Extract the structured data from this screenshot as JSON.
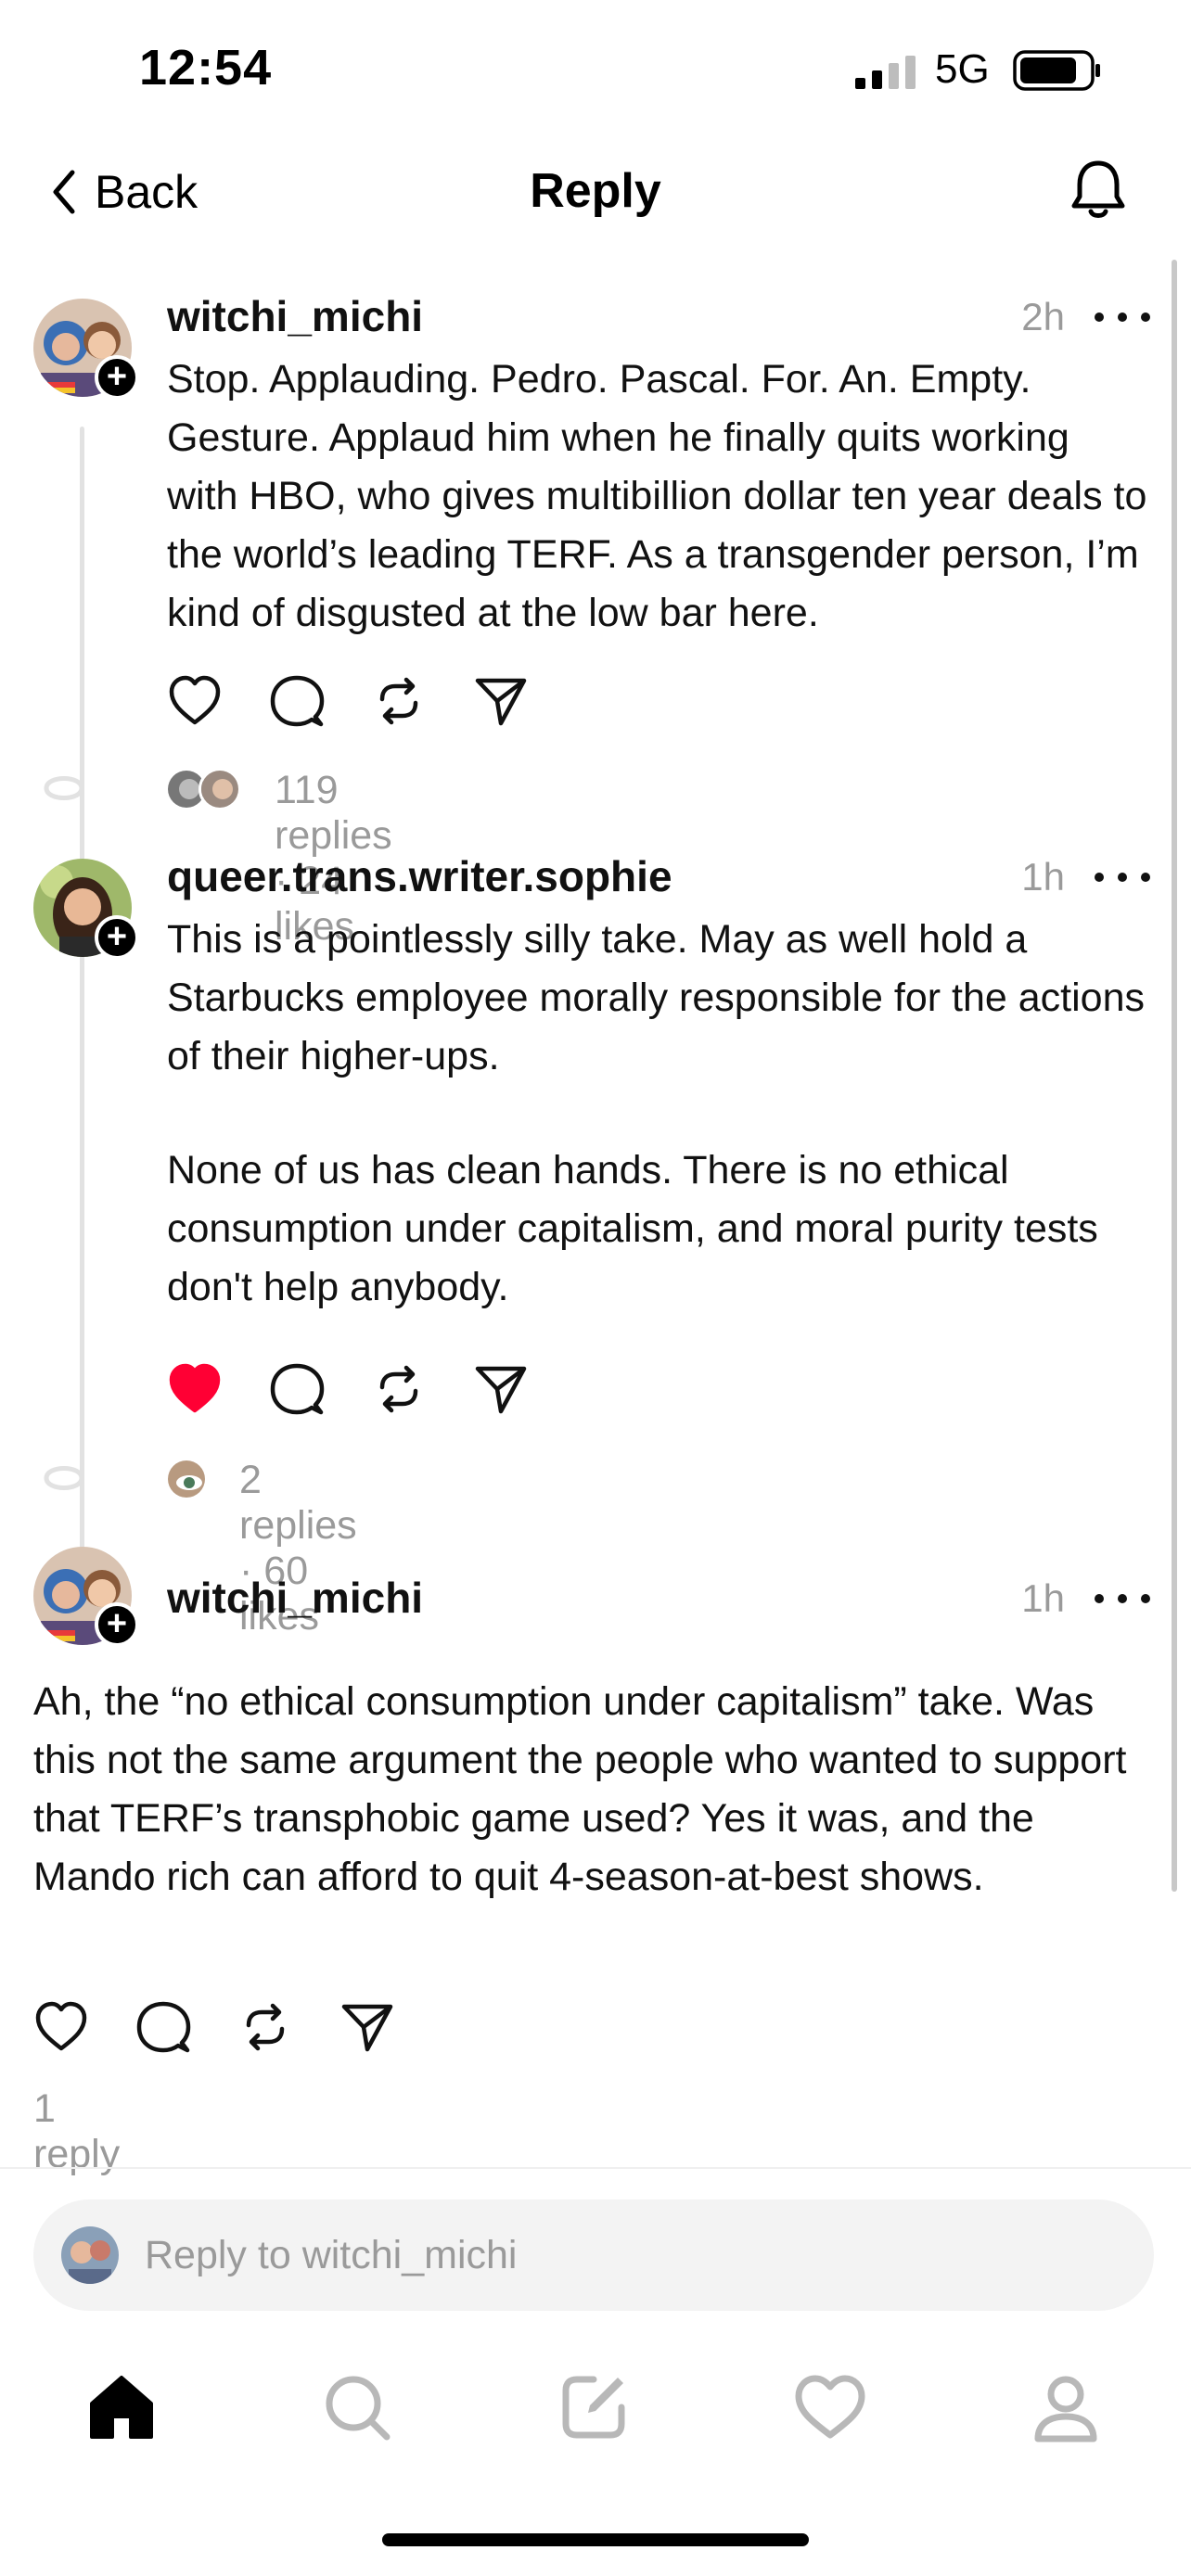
{
  "status_bar": {
    "time": "12:54",
    "network": "5G"
  },
  "nav": {
    "back_label": "Back",
    "title": "Reply"
  },
  "posts": [
    {
      "username": "witchi_michi",
      "timestamp": "2h",
      "paragraphs": [
        "Stop. Applauding. Pedro. Pascal. For. An. Empty. Gesture. Applaud him when he finally quits working with HBO, who gives multibillion dollar ten year deals to the world’s leading TERF. As a transgender person, I’m kind of disgusted at the low bar here."
      ],
      "liked": false,
      "replies": "119 replies",
      "separator": "·",
      "likes": "24 likes"
    },
    {
      "username": "queer.trans.writer.sophie",
      "timestamp": "1h",
      "paragraphs": [
        "This is a pointlessly silly take. May as well hold a Starbucks employee morally responsible for the actions of their higher-ups.",
        "None of us has clean hands. There is no ethical consumption under capitalism, and moral purity tests don't help anybody."
      ],
      "liked": true,
      "replies": "2 replies",
      "separator": "·",
      "likes": "60 likes"
    },
    {
      "username": "witchi_michi",
      "timestamp": "1h",
      "paragraphs": [
        "Ah, the “no ethical consumption under capitalism” take. Was this not the same argument the people who wanted to support that TERF’s transphobic game used? Yes it was, and the Mando rich can afford to quit 4-season-at-best shows."
      ],
      "liked": false,
      "replies": "1 reply"
    }
  ],
  "reply_bar": {
    "placeholder": "Reply to witchi_michi"
  },
  "colors": {
    "like_red": "#ff0034",
    "muted": "#9a9a9a",
    "thread_line": "#e2e2e2"
  },
  "tabs": [
    "home-icon",
    "search-icon",
    "compose-icon",
    "activity-icon",
    "profile-icon"
  ]
}
